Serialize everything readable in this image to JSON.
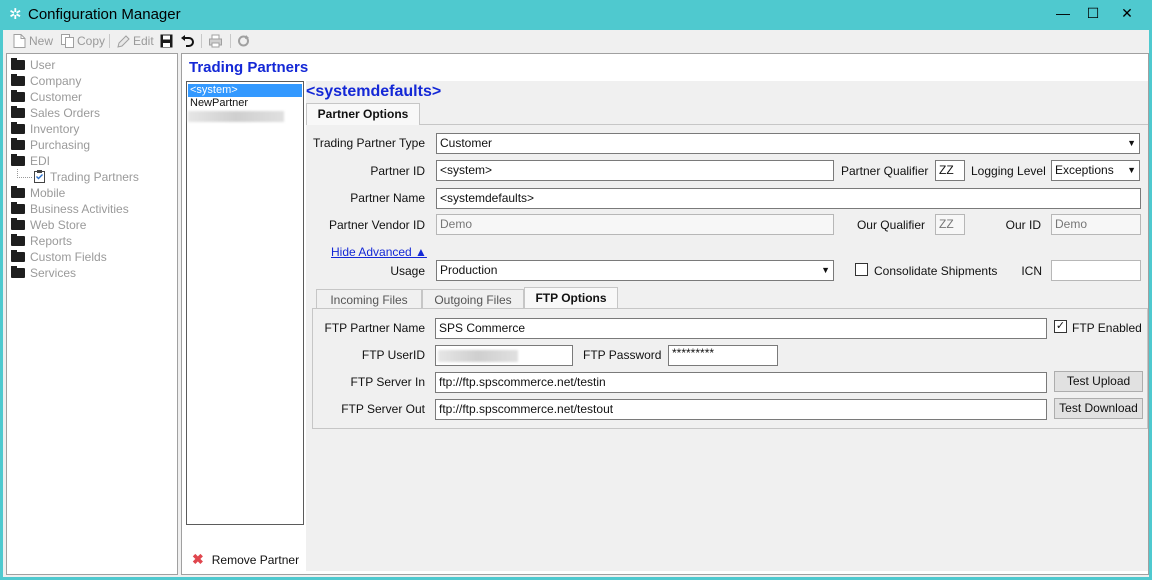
{
  "window": {
    "title": "Configuration Manager",
    "minimize": "—",
    "maximize": "☐",
    "close": "✕"
  },
  "toolbar": {
    "new": "New",
    "copy": "Copy",
    "edit": "Edit"
  },
  "nav": {
    "items": [
      "User",
      "Company",
      "Customer",
      "Sales Orders",
      "Inventory",
      "Purchasing",
      "EDI",
      "Trading Partners",
      "Mobile",
      "Business Activities",
      "Web Store",
      "Reports",
      "Custom Fields",
      "Services"
    ]
  },
  "page": {
    "heading": "Trading Partners",
    "selected_name": "<systemdefaults>"
  },
  "partners": {
    "items": [
      "<system>",
      "NewPartner"
    ]
  },
  "remove_label": "Remove Partner",
  "tabs": {
    "partner_options": "Partner Options"
  },
  "form": {
    "trading_partner_type_label": "Trading Partner Type",
    "trading_partner_type": "Customer",
    "partner_id_label": "Partner ID",
    "partner_id": "<system>",
    "partner_qualifier_label": "Partner Qualifier",
    "partner_qualifier": "ZZ",
    "logging_level_label": "Logging Level",
    "logging_level": "Exceptions",
    "partner_name_label": "Partner Name",
    "partner_name": "<systemdefaults>",
    "partner_vendor_id_label": "Partner Vendor ID",
    "partner_vendor_id": "Demo",
    "our_qualifier_label": "Our Qualifier",
    "our_qualifier": "ZZ",
    "our_id_label": "Our ID",
    "our_id": "Demo",
    "hide_advanced": "Hide Advanced ▲",
    "usage_label": "Usage",
    "usage": "Production",
    "consolidate_label": "Consolidate Shipments",
    "icn_label": "ICN",
    "icn": ""
  },
  "subtabs": {
    "incoming": "Incoming Files",
    "outgoing": "Outgoing Files",
    "ftp": "FTP Options"
  },
  "ftp": {
    "partner_name_label": "FTP Partner Name",
    "partner_name": "SPS Commerce",
    "enabled_label": "FTP Enabled",
    "enabled_check": "✓",
    "userid_label": "FTP UserID",
    "password_label": "FTP Password",
    "password": "*********",
    "server_in_label": "FTP Server In",
    "server_in": "ftp://ftp.spscommerce.net/testin",
    "server_out_label": "FTP Server Out",
    "server_out": "ftp://ftp.spscommerce.net/testout",
    "test_upload": "Test Upload",
    "test_download": "Test Download"
  }
}
